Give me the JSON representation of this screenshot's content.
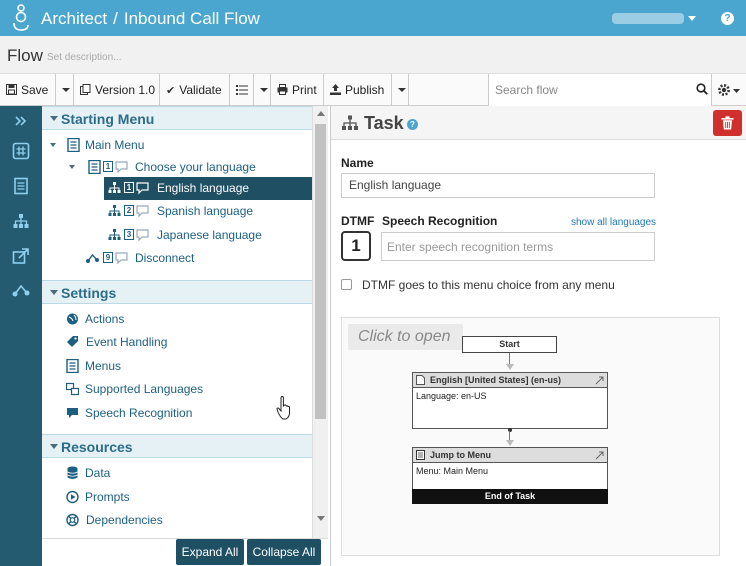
{
  "header": {
    "app_name": "Architect",
    "separator": "/",
    "flow_name": "Inbound Call Flow",
    "help_label": "?"
  },
  "flowbar": {
    "title": "Flow",
    "description_placeholder": "Set description..."
  },
  "toolbar": {
    "save": "Save",
    "version": "Version 1.0",
    "validate": "Validate",
    "print": "Print",
    "publish": "Publish",
    "search_placeholder": "Search flow"
  },
  "rail": {
    "icons": [
      "expand-icon",
      "hash-icon",
      "document-icon",
      "hierarchy-icon",
      "share-icon",
      "flow-icon"
    ]
  },
  "tree": {
    "sections": [
      {
        "label": "Starting Menu"
      },
      {
        "label": "Settings"
      },
      {
        "label": "Resources"
      }
    ],
    "starting_menu": {
      "main_menu": "Main Menu",
      "choose_language": "Choose your language",
      "choose_digit": "1",
      "english": "English language",
      "english_digit": "1",
      "spanish": "Spanish language",
      "spanish_digit": "2",
      "japanese": "Japanese language",
      "japanese_digit": "3",
      "disconnect": "Disconnect",
      "disconnect_digit": "9"
    },
    "settings": [
      "Actions",
      "Event Handling",
      "Menus",
      "Supported Languages",
      "Speech Recognition"
    ],
    "resources": [
      "Data",
      "Prompts",
      "Dependencies"
    ]
  },
  "buttons": {
    "expand_all": "Expand All",
    "collapse_all": "Collapse All"
  },
  "task": {
    "title": "Task",
    "help": "?",
    "name_label": "Name",
    "name_value": "English language",
    "dtmf_label": "DTMF",
    "dtmf_value": "1",
    "speech_label": "Speech Recognition",
    "show_all": "show all languages",
    "speech_placeholder": "Enter speech recognition terms",
    "checkbox_label": "DTMF goes to this menu choice from any menu"
  },
  "preview": {
    "click_to_open": "Click to open",
    "start": "Start",
    "node1_title": "English [United States] (en-us)",
    "node1_body": "Language: en-US",
    "node2_title": "Jump to Menu",
    "node2_body": "Menu: Main Menu",
    "end": "End of Task"
  },
  "colors": {
    "header_bg": "#4aa5cf",
    "rail_bg": "#255b70",
    "selected_bg": "#1e4f63",
    "delete_bg": "#d0302b",
    "link_color": "#1d5f82"
  }
}
